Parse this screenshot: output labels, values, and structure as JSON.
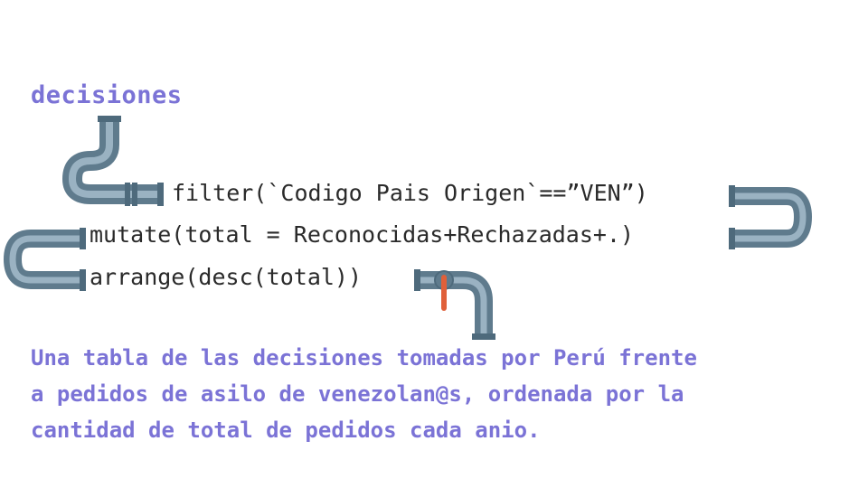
{
  "title": "decisiones",
  "code_lines": [
    "filter(`Codigo Pais Origen`==”VEN”)",
    "mutate(total = Reconocidas+Rechazadas+.)",
    "arrange(desc(total))"
  ],
  "caption_lines": [
    "Una tabla de las decisiones tomadas por Perú frente",
    "a pedidos de asilo de venezolan@s, ordenada por la",
    "cantidad de total de pedidos cada anio."
  ],
  "colors": {
    "accent": "#7b73d6",
    "pipe": "#7f9cb0",
    "pipe_dark": "#5a7688",
    "valve": "#e0603a"
  }
}
